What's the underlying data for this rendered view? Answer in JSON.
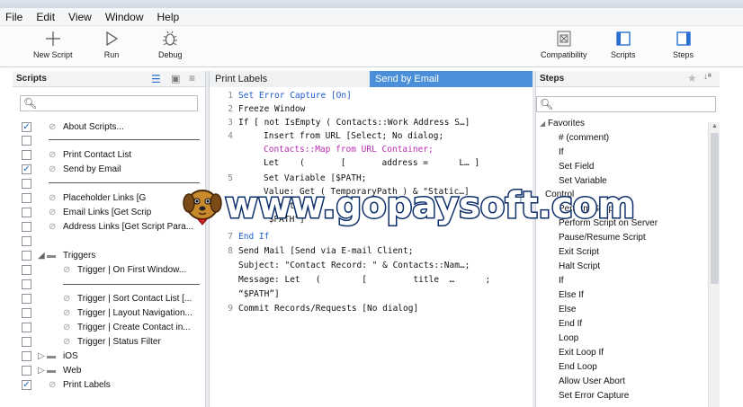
{
  "menu": [
    "File",
    "Edit",
    "View",
    "Window",
    "Help"
  ],
  "toolbar": {
    "new_script": "New Script",
    "run": "Run",
    "debug": "Debug",
    "compatibility": "Compatibility",
    "scripts": "Scripts",
    "steps": "Steps"
  },
  "scripts_panel": {
    "header": "Scripts",
    "search_placeholder": "",
    "items": [
      {
        "label": "About Scripts...",
        "checked": true
      },
      {
        "label": "Print Contact List",
        "checked": false
      },
      {
        "label": "Send by Email",
        "checked": true
      },
      {
        "label": "Placeholder Links [G",
        "checked": false
      },
      {
        "label": "Email Links [Get Scrip",
        "checked": false
      },
      {
        "label": "Address Links [Get Script Para...",
        "checked": false
      },
      {
        "label": "Triggers",
        "checked": false
      },
      {
        "label": "Trigger | On First Window...",
        "checked": false
      },
      {
        "label": "Trigger | Sort Contact List [...",
        "checked": false
      },
      {
        "label": "Trigger | Layout Navigation...",
        "checked": false
      },
      {
        "label": "Trigger | Create Contact in...",
        "checked": false
      },
      {
        "label": "Trigger | Status Filter",
        "checked": false
      },
      {
        "label": "iOS",
        "checked": false
      },
      {
        "label": "Web",
        "checked": false
      },
      {
        "label": "Print Labels",
        "checked": true
      }
    ]
  },
  "editor": {
    "tab_inactive": "Print Labels",
    "tab_active": "Send by Email",
    "lines": [
      {
        "num": "1",
        "text": "Set Error Capture [On]"
      },
      {
        "num": "2",
        "text": "Freeze Window"
      },
      {
        "num": "3",
        "text": "If [ not IsEmpty ( Contacts::Work Address S…]"
      },
      {
        "num": "4",
        "text": "Insert from URL [Select; No dialog;"
      },
      {
        "num": "",
        "text": "Contacts::Map from URL Container;"
      },
      {
        "num": "",
        "text": "Let    (       [       address =      L… ]"
      },
      {
        "num": "5",
        "text": "Set Variable [$PATH;"
      },
      {
        "num": "",
        "text": "Value: Get ( TemporaryPath ) & \"Static…]"
      },
      {
        "num": "6",
        "text": "Export"
      },
      {
        "num": "",
        "text": "“$PATH”]"
      },
      {
        "num": "7",
        "text": "End If"
      },
      {
        "num": "8",
        "text": "Send Mail [Send via E-mail Client;"
      },
      {
        "num": "",
        "text": "Subject: \"Contact Record: \" & Contacts::Nam…;"
      },
      {
        "num": "",
        "text": "Message: Let   (        [         title  …      ;"
      },
      {
        "num": "",
        "text": "“$PATH”]"
      },
      {
        "num": "9",
        "text": "Commit Records/Requests [No dialog]"
      }
    ]
  },
  "steps_panel": {
    "header": "Steps",
    "search_placeholder": "",
    "favorites_label": "Favorites",
    "favorites": [
      "# (comment)",
      "If",
      "Set Field",
      "Set Variable"
    ],
    "control_label": "Control",
    "control": [
      "Perform Script",
      "Perform Script on Server",
      "Pause/Resume Script",
      "Exit Script",
      "Halt Script",
      "If",
      "Else If",
      "Else",
      "End If",
      "Loop",
      "Exit Loop If",
      "End Loop",
      "Allow User Abort",
      "Set Error Capture"
    ]
  },
  "watermark": "www.gopaysoft.com",
  "colors": {
    "accent": "#4a8fd9",
    "keyword_blue": "#1f5cc9",
    "keyword_magenta": "#b62cb1"
  }
}
